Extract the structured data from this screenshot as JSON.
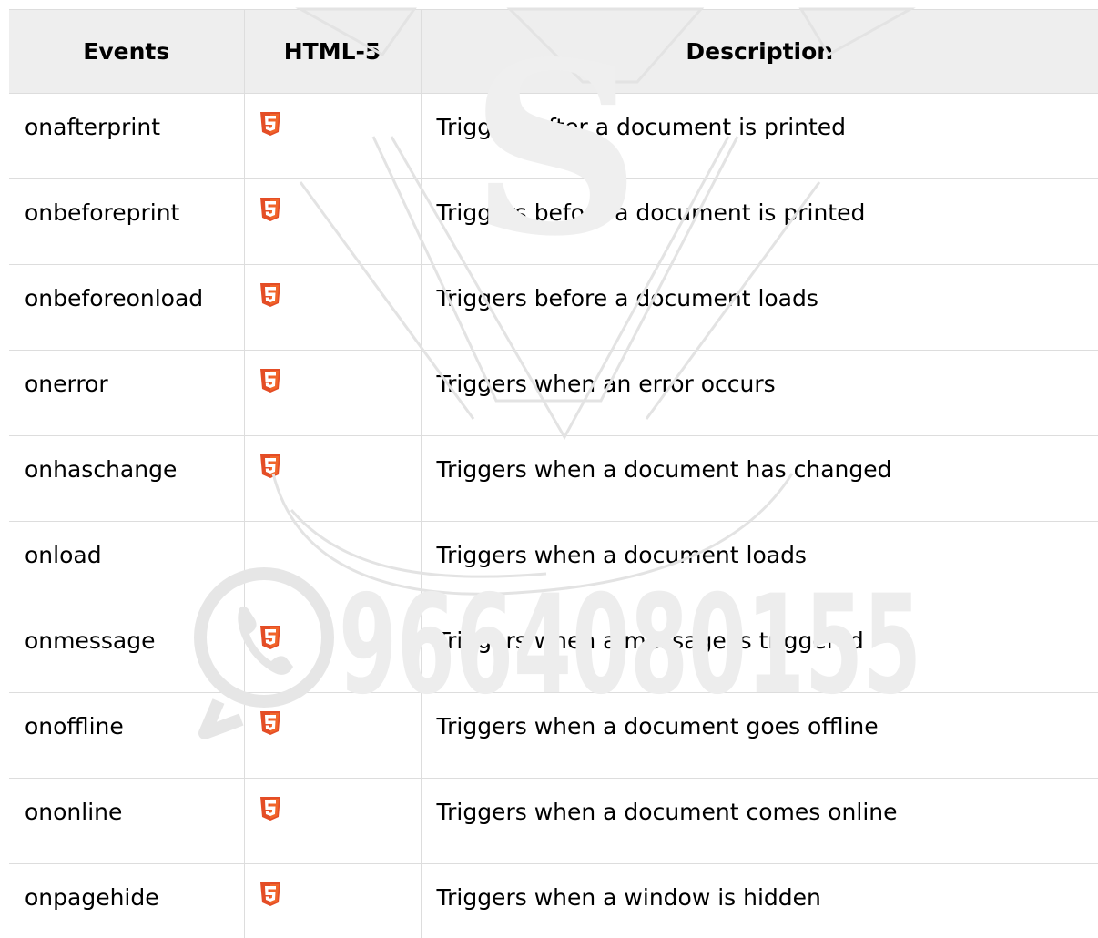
{
  "table": {
    "headers": {
      "events": "Events",
      "html5": "HTML-5",
      "description": "Description"
    },
    "rows": [
      {
        "event": "onafterprint",
        "html5": true,
        "description": "Triggers after a document is printed"
      },
      {
        "event": "onbeforeprint",
        "html5": true,
        "description": "Triggers before a document is printed"
      },
      {
        "event": "onbeforeonload",
        "html5": true,
        "description": "Triggers before a document loads"
      },
      {
        "event": "onerror",
        "html5": true,
        "description": "Triggers when an error occurs"
      },
      {
        "event": "onhaschange",
        "html5": true,
        "description": "Triggers when a document has changed"
      },
      {
        "event": "onload",
        "html5": false,
        "description": "Triggers when a document loads"
      },
      {
        "event": "onmessage",
        "html5": true,
        "description": "Triggers when a message is triggered"
      },
      {
        "event": "onoffline",
        "html5": true,
        "description": "Triggers when a document goes offline"
      },
      {
        "event": "ononline",
        "html5": true,
        "description": "Triggers when a document comes online"
      },
      {
        "event": "onpagehide",
        "html5": true,
        "description": "Triggers when a window is hidden"
      }
    ]
  },
  "icons": {
    "html5_badge": "html5-icon"
  },
  "watermark": {
    "phone": "9664080155",
    "logo_letter": "S"
  },
  "colors": {
    "header_bg": "#eeeeee",
    "border": "#dddddd",
    "html5_orange": "#e44d26",
    "html5_orange_light": "#f16529",
    "watermark": "#e6e6e6"
  }
}
